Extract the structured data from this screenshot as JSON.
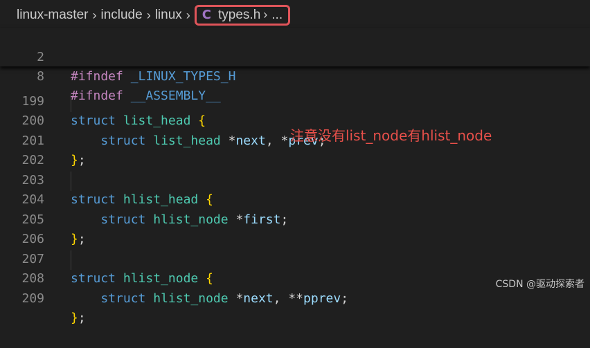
{
  "breadcrumb": {
    "segments": [
      "linux-master",
      "include",
      "linux"
    ],
    "file_icon": "C",
    "file_name": "types.h",
    "ellipsis": "..."
  },
  "sticky_lines": [
    {
      "num": "2",
      "directive": "#ifndef",
      "macro": "_LINUX_TYPES_H"
    },
    {
      "num": "8",
      "directive": "#ifndef",
      "macro": "__ASSEMBLY__"
    }
  ],
  "code": {
    "line_numbers": [
      "199",
      "200",
      "201",
      "202",
      "203",
      "204",
      "205",
      "206",
      "207",
      "208",
      "209"
    ],
    "struct_keyword": "struct",
    "list_head": "list_head",
    "hlist_head": "hlist_head",
    "hlist_node": "hlist_node",
    "next": "next",
    "prev": "prev",
    "first": "first",
    "pprev": "pprev"
  },
  "annotation": "注意没有list_node有hlist_node",
  "watermark": "CSDN @驱动探索者",
  "colors": {
    "background": "#1f1f1f",
    "highlight_box": "#e0555a",
    "annotation": "#e8504a"
  }
}
